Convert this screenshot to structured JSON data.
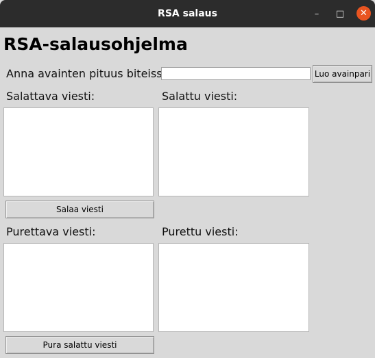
{
  "window": {
    "title": "RSA salaus",
    "minimize_glyph": "–",
    "maximize_glyph": "□",
    "close_glyph": "✕"
  },
  "app": {
    "heading": "RSA-salausohjelma"
  },
  "keygen": {
    "label": "Anna avainten pituus biteissä:",
    "input_value": "",
    "button_label": "Luo avainpari"
  },
  "encrypt": {
    "input_label": "Salattava viesti:",
    "output_label": "Salattu viesti:",
    "input_value": "",
    "output_value": "",
    "button_label": "Salaa viesti"
  },
  "decrypt": {
    "input_label": "Purettava viesti:",
    "output_label": "Purettu viesti:",
    "input_value": "",
    "output_value": "",
    "button_label": "Pura salattu viesti"
  },
  "colors": {
    "titlebar": "#2c2c2c",
    "window_bg": "#d9d9d9",
    "close_button": "#e95420"
  }
}
